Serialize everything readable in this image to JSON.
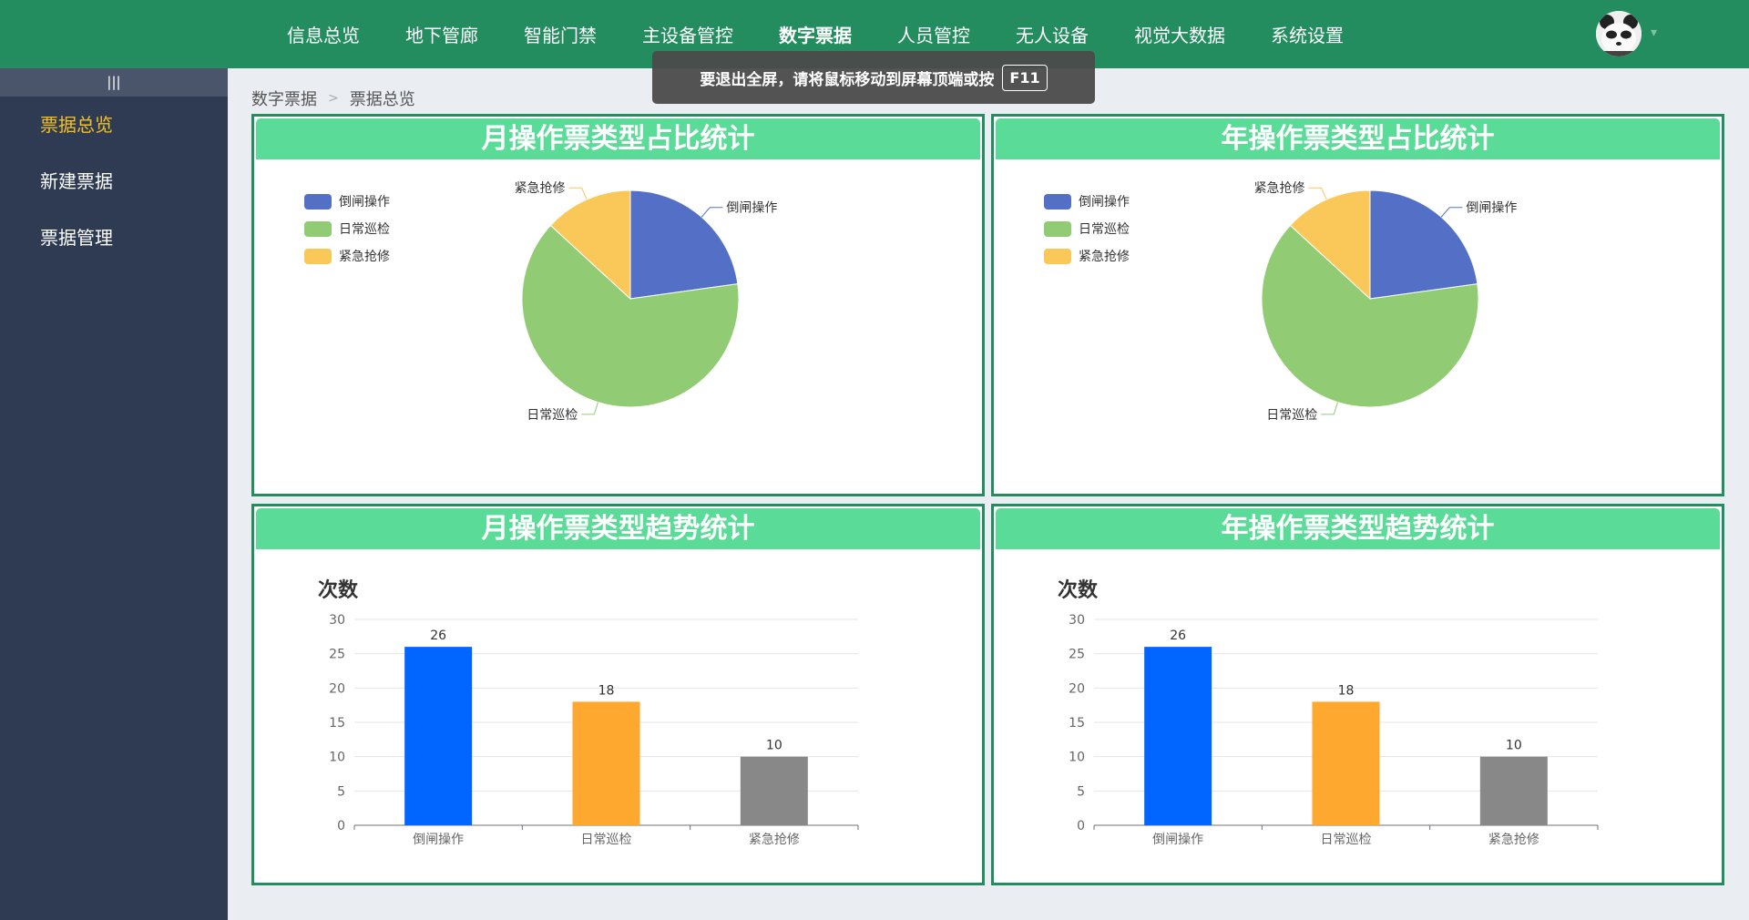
{
  "header": {
    "nav": [
      {
        "label": "信息总览"
      },
      {
        "label": "地下管廊"
      },
      {
        "label": "智能门禁"
      },
      {
        "label": "主设备管控"
      },
      {
        "label": "数字票据",
        "active": true
      },
      {
        "label": "人员管控"
      },
      {
        "label": "无人设备"
      },
      {
        "label": "视觉大数据"
      },
      {
        "label": "系统设置"
      }
    ]
  },
  "toast": {
    "text": "要退出全屏，请将鼠标移动到屏幕顶端或按",
    "key": "F11"
  },
  "sidebar": {
    "toggle": "|||",
    "items": [
      {
        "label": "票据总览",
        "active": true
      },
      {
        "label": "新建票据"
      },
      {
        "label": "票据管理"
      }
    ]
  },
  "breadcrumb": {
    "items": [
      "数字票据",
      "票据总览"
    ],
    "separator": ">"
  },
  "panels": {
    "monthly_pie_title": "月操作票类型占比统计",
    "yearly_pie_title": "年操作票类型占比统计",
    "monthly_bar_title": "月操作票类型趋势统计",
    "yearly_bar_title": "年操作票类型趋势统计"
  },
  "colors": {
    "header_bg": "#248d60",
    "sidebar_bg": "#2e3b53",
    "panel_header": "#5bdb98",
    "active_side": "#f2c027"
  },
  "chart_data": [
    {
      "type": "pie",
      "title": "月操作票类型占比统计",
      "legend_position": "top-left",
      "categories": [
        "倒闸操作",
        "日常巡检",
        "紧急抢修"
      ],
      "values": [
        26,
        73,
        15
      ],
      "colors": [
        "#5470c6",
        "#91cc75",
        "#fac858"
      ]
    },
    {
      "type": "pie",
      "title": "年操作票类型占比统计",
      "legend_position": "top-left",
      "categories": [
        "倒闸操作",
        "日常巡检",
        "紧急抢修"
      ],
      "values": [
        26,
        73,
        15
      ],
      "colors": [
        "#5470c6",
        "#91cc75",
        "#fac858"
      ]
    },
    {
      "type": "bar",
      "title": "月操作票类型趋势统计",
      "ylabel": "次数",
      "categories": [
        "倒闸操作",
        "日常巡检",
        "紧急抢修"
      ],
      "values": [
        26,
        18,
        10
      ],
      "colors": [
        "#0066ff",
        "#ffa830",
        "#888888"
      ],
      "ylim": [
        0,
        30
      ],
      "yticks": [
        0,
        5,
        10,
        15,
        20,
        25,
        30
      ],
      "grid": true
    },
    {
      "type": "bar",
      "title": "年操作票类型趋势统计",
      "ylabel": "次数",
      "categories": [
        "倒闸操作",
        "日常巡检",
        "紧急抢修"
      ],
      "values": [
        26,
        18,
        10
      ],
      "colors": [
        "#0066ff",
        "#ffa830",
        "#888888"
      ],
      "ylim": [
        0,
        30
      ],
      "yticks": [
        0,
        5,
        10,
        15,
        20,
        25,
        30
      ],
      "grid": true
    }
  ]
}
